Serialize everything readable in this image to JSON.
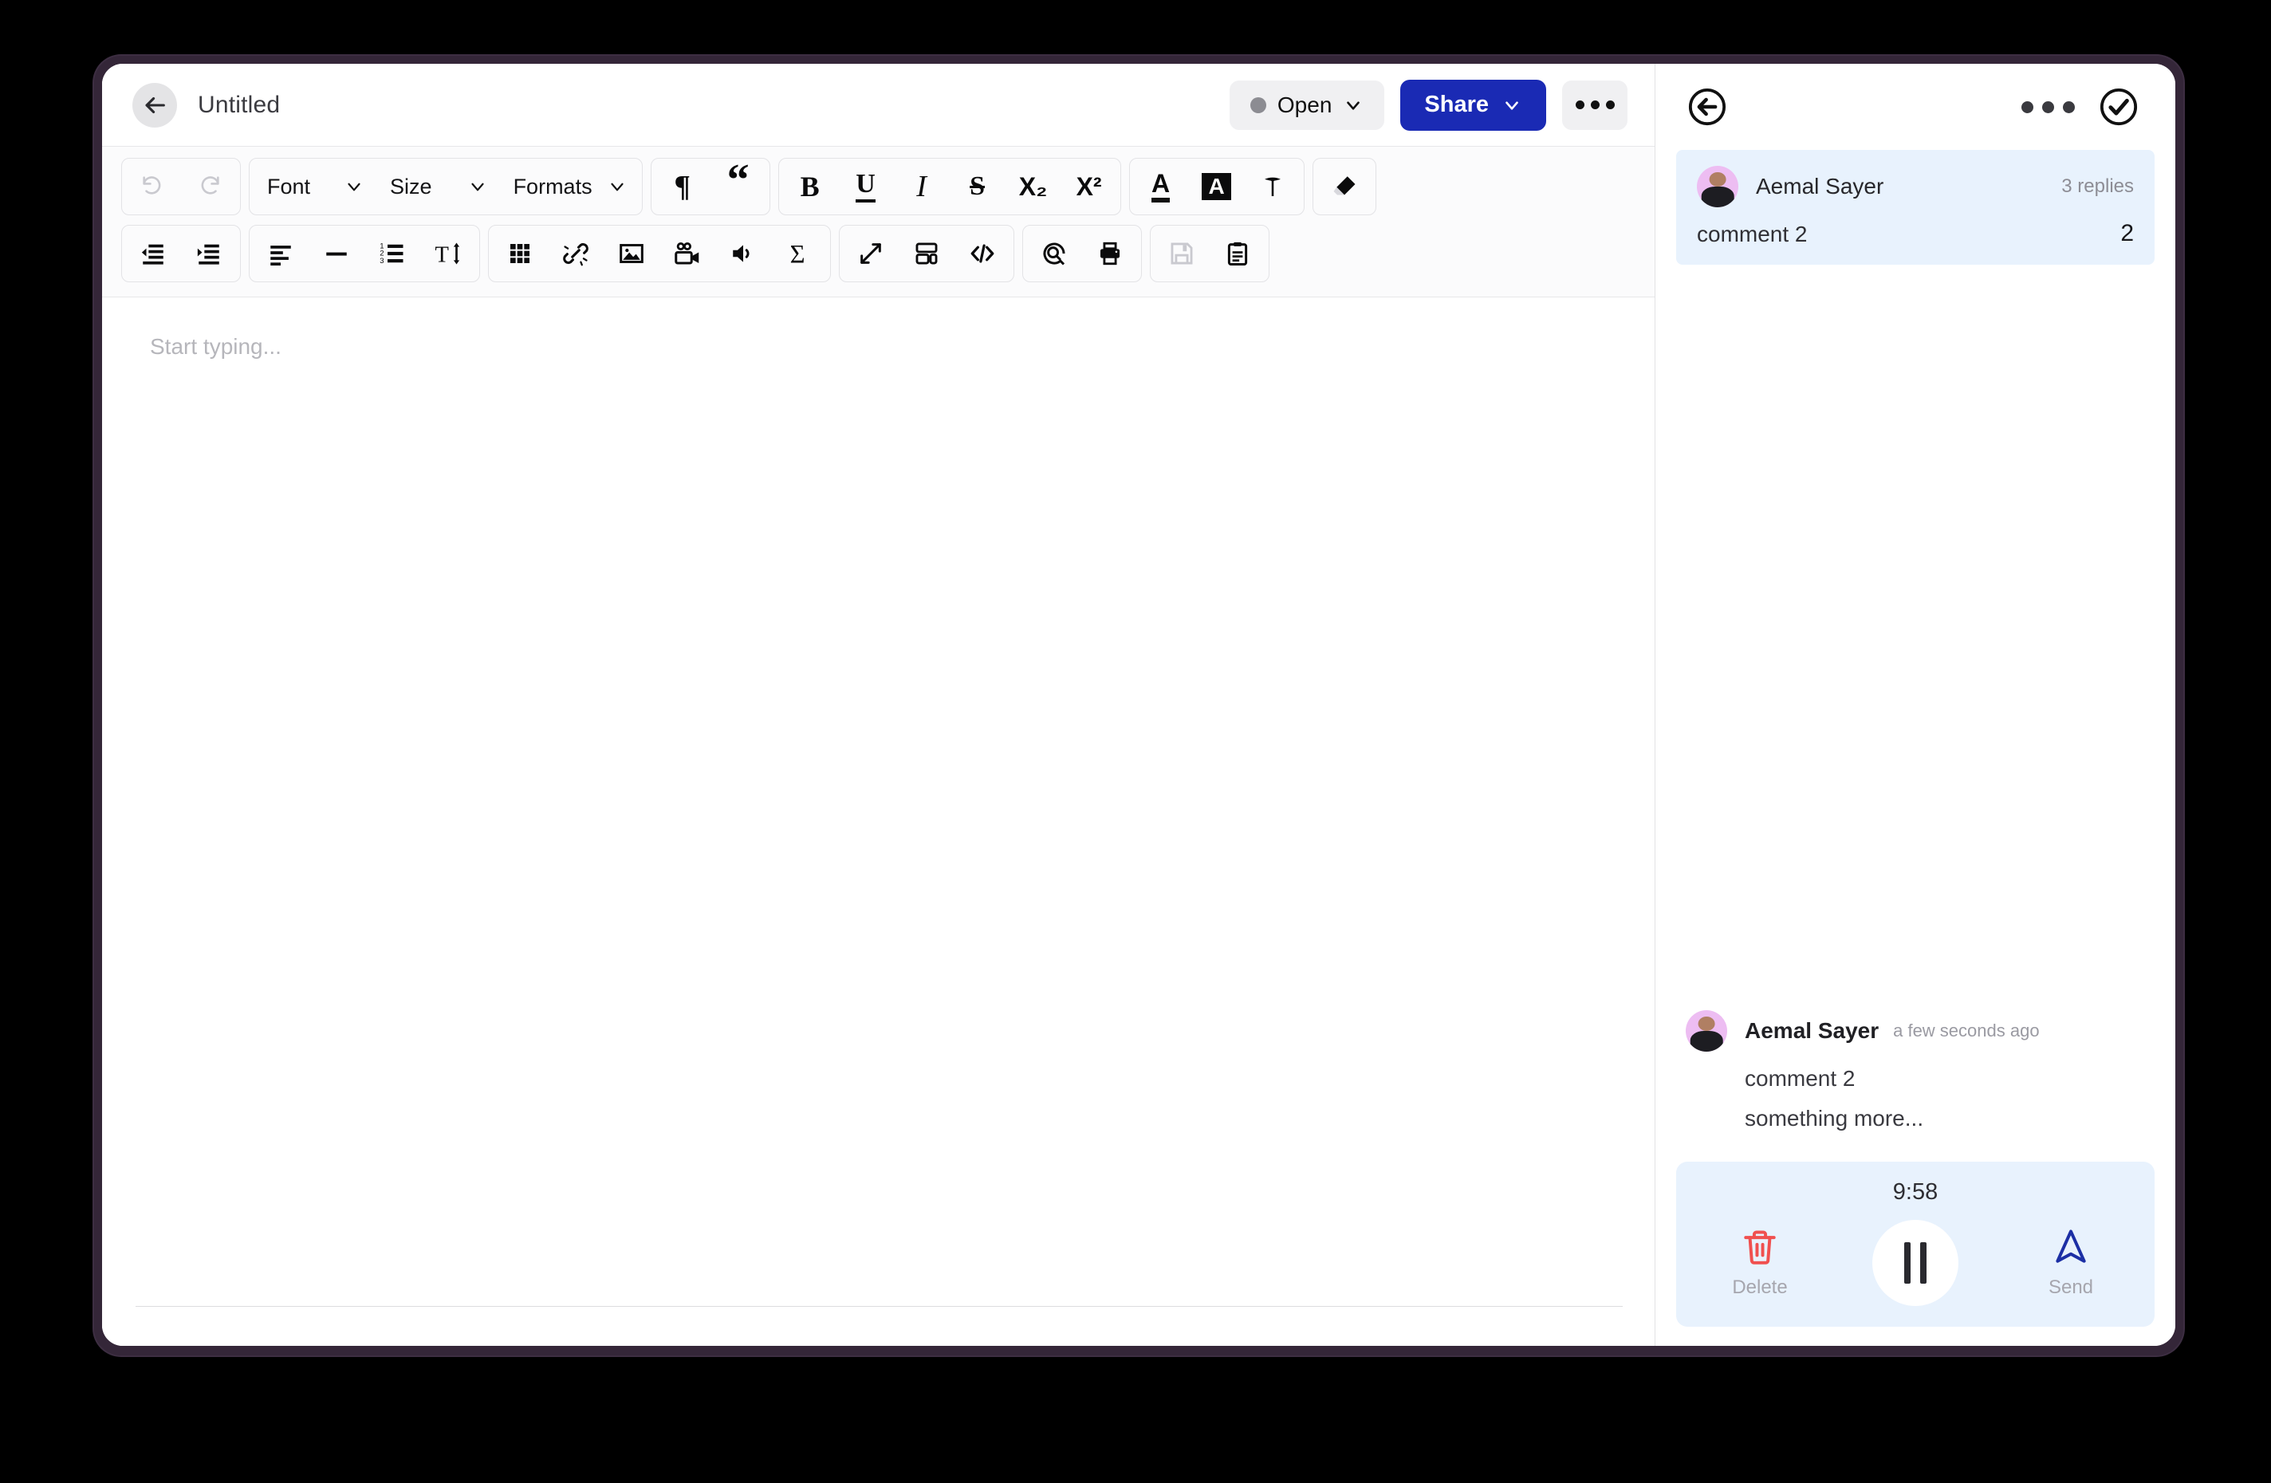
{
  "document": {
    "back_icon": "arrow-left-icon",
    "title": "Untitled",
    "status": {
      "label": "Open",
      "dot_color": "#8c8c92",
      "chevron_icon": "chevron-down-icon"
    },
    "share": {
      "label": "Share",
      "chevron_icon": "chevron-down-icon",
      "color": "#1a2ab4"
    },
    "more_icon": "ellipsis-icon"
  },
  "toolbar": {
    "row1": [
      {
        "name": "undo-button",
        "icon": "undo-icon",
        "glyph": "",
        "disabled": true
      },
      {
        "name": "redo-button",
        "icon": "redo-icon",
        "glyph": "",
        "disabled": true
      },
      {
        "name": "font-select",
        "label": "Font"
      },
      {
        "name": "size-select",
        "label": "Size"
      },
      {
        "name": "formats-select",
        "label": "Formats"
      },
      {
        "name": "paragraph-button",
        "icon": "pilcrow-icon",
        "glyph": "¶"
      },
      {
        "name": "blockquote-button",
        "icon": "quote-icon",
        "glyph": "“"
      },
      {
        "name": "bold-button",
        "icon": "bold-icon",
        "glyph": "B"
      },
      {
        "name": "underline-button",
        "icon": "underline-icon",
        "glyph": "U"
      },
      {
        "name": "italic-button",
        "icon": "italic-icon",
        "glyph": "I"
      },
      {
        "name": "strikethrough-button",
        "icon": "strikethrough-icon",
        "glyph": "S"
      },
      {
        "name": "subscript-button",
        "icon": "subscript-icon",
        "glyph": "X₂"
      },
      {
        "name": "superscript-button",
        "icon": "superscript-icon",
        "glyph": "X²"
      },
      {
        "name": "text-color-button",
        "icon": "text-color-icon",
        "glyph": "A"
      },
      {
        "name": "highlight-color-button",
        "icon": "highlight-color-icon",
        "glyph": "A"
      },
      {
        "name": "format-painter-button",
        "icon": "format-painter-icon",
        "glyph": "T"
      },
      {
        "name": "clear-formatting-button",
        "icon": "eraser-icon",
        "glyph": ""
      }
    ],
    "row2": [
      {
        "name": "outdent-button",
        "icon": "outdent-icon"
      },
      {
        "name": "indent-button",
        "icon": "indent-icon"
      },
      {
        "name": "align-left-button",
        "icon": "align-left-icon"
      },
      {
        "name": "horizontal-rule-button",
        "icon": "horizontal-rule-icon"
      },
      {
        "name": "numbered-list-button",
        "icon": "numbered-list-icon"
      },
      {
        "name": "line-height-button",
        "icon": "line-height-icon"
      },
      {
        "name": "table-button",
        "icon": "table-grid-icon"
      },
      {
        "name": "unlink-button",
        "icon": "unlink-icon"
      },
      {
        "name": "image-button",
        "icon": "image-icon"
      },
      {
        "name": "video-button",
        "icon": "video-camera-icon"
      },
      {
        "name": "audio-button",
        "icon": "speaker-icon"
      },
      {
        "name": "equation-button",
        "icon": "sigma-icon"
      },
      {
        "name": "fullscreen-button",
        "icon": "expand-arrows-icon"
      },
      {
        "name": "template-button",
        "icon": "layout-icon"
      },
      {
        "name": "source-code-button",
        "icon": "code-icon"
      },
      {
        "name": "find-replace-button",
        "icon": "search-circle-icon"
      },
      {
        "name": "print-button",
        "icon": "printer-icon"
      },
      {
        "name": "save-button",
        "icon": "floppy-disk-icon",
        "disabled": true
      },
      {
        "name": "paste-button",
        "icon": "clipboard-icon"
      }
    ]
  },
  "editor": {
    "placeholder": "Start typing..."
  },
  "comments_panel": {
    "back_icon": "circle-arrow-left-icon",
    "more_icon": "ellipsis-icon",
    "resolve_icon": "circle-check-icon",
    "selected_comment": {
      "author": "Aemal Sayer",
      "replies_label": "3 replies",
      "text": "comment 2",
      "count": "2",
      "background": "#e8f2fd"
    },
    "thread": {
      "author": "Aemal Sayer",
      "time": "a few seconds ago",
      "lines": [
        "comment 2",
        "something more..."
      ]
    },
    "recorder": {
      "time": "9:58",
      "delete_label": "Delete",
      "delete_icon": "trash-icon",
      "delete_color": "#f0504f",
      "pause_icon": "pause-icon",
      "send_label": "Send",
      "send_icon": "send-arrow-icon",
      "send_color": "#1c2fa5",
      "background": "#e8f2fd"
    }
  }
}
